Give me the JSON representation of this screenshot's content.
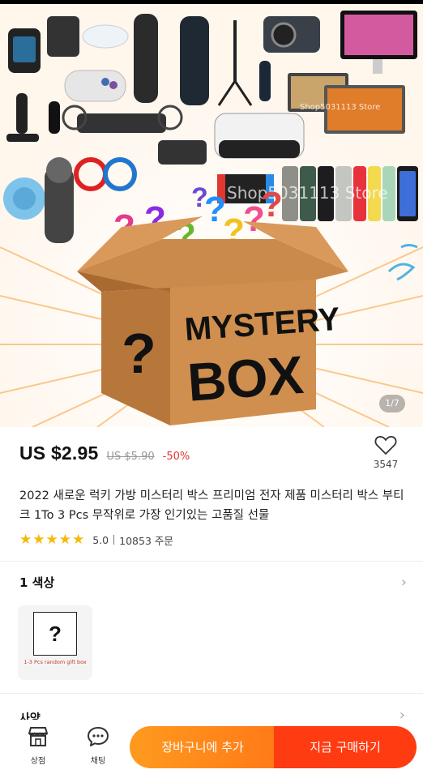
{
  "image": {
    "counter": "1/7",
    "box_text_line1": "MYSTERY",
    "box_text_line2": "BOX",
    "box_question": "?",
    "watermark": "Shop5031113 Store",
    "variant_box_caption": "1-3 Pcs random gift box"
  },
  "product": {
    "price": "US $2.95",
    "original_price": "US $5.90",
    "discount": "-50%",
    "wishlist_count": "3547",
    "title": "2022 새로운 럭키 가방 미스터리 박스 프리미엄 전자 제품 미스터리 박스 부티크 1To 3 Pcs 무작위로 가장 인기있는 고품질 선물",
    "rating": "5.0",
    "orders": "10853 주문"
  },
  "sections": {
    "color_label": "1 색상",
    "variant_symbol": "?",
    "spec_label_partial": "사양"
  },
  "bottom_bar": {
    "store_label": "상점",
    "chat_label": "채팅",
    "add_to_cart": "장바구니에 추가",
    "buy_now": "지금 구매하기"
  },
  "colors": {
    "accent_orange": "#ff7a18",
    "buy_red": "#ff3b12",
    "discount_red": "#e8322d",
    "star": "#f5b90a"
  },
  "icons": [
    "heart-icon",
    "chevron-right-icon",
    "store-icon",
    "chat-icon",
    "star-icon"
  ]
}
